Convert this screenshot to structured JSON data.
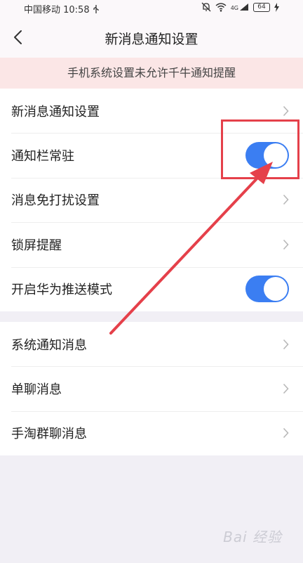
{
  "status_bar": {
    "carrier_time": "中国移动 10:58",
    "usb_icon": "usb-icon",
    "network": "4G",
    "battery": "64"
  },
  "header": {
    "title": "新消息通知设置",
    "back_icon": "back-arrow-icon"
  },
  "banner": {
    "text": "手机系统设置未允许千牛通知提醒"
  },
  "section1": {
    "items": [
      {
        "label": "新消息通知设置",
        "type": "link"
      },
      {
        "label": "通知栏常驻",
        "type": "toggle",
        "on": true
      },
      {
        "label": "消息免打扰设置",
        "type": "link"
      },
      {
        "label": "锁屏提醒",
        "type": "link"
      },
      {
        "label": "开启华为推送模式",
        "type": "toggle",
        "on": true
      }
    ]
  },
  "section2": {
    "items": [
      {
        "label": "系统通知消息",
        "type": "link"
      },
      {
        "label": "单聊消息",
        "type": "link"
      },
      {
        "label": "手淘群聊消息",
        "type": "link"
      }
    ]
  },
  "colors": {
    "toggle_on": "#3b7ef2",
    "banner_bg": "#fbe6e6",
    "annotation": "#e5404a"
  },
  "watermark": "Bai 经验"
}
